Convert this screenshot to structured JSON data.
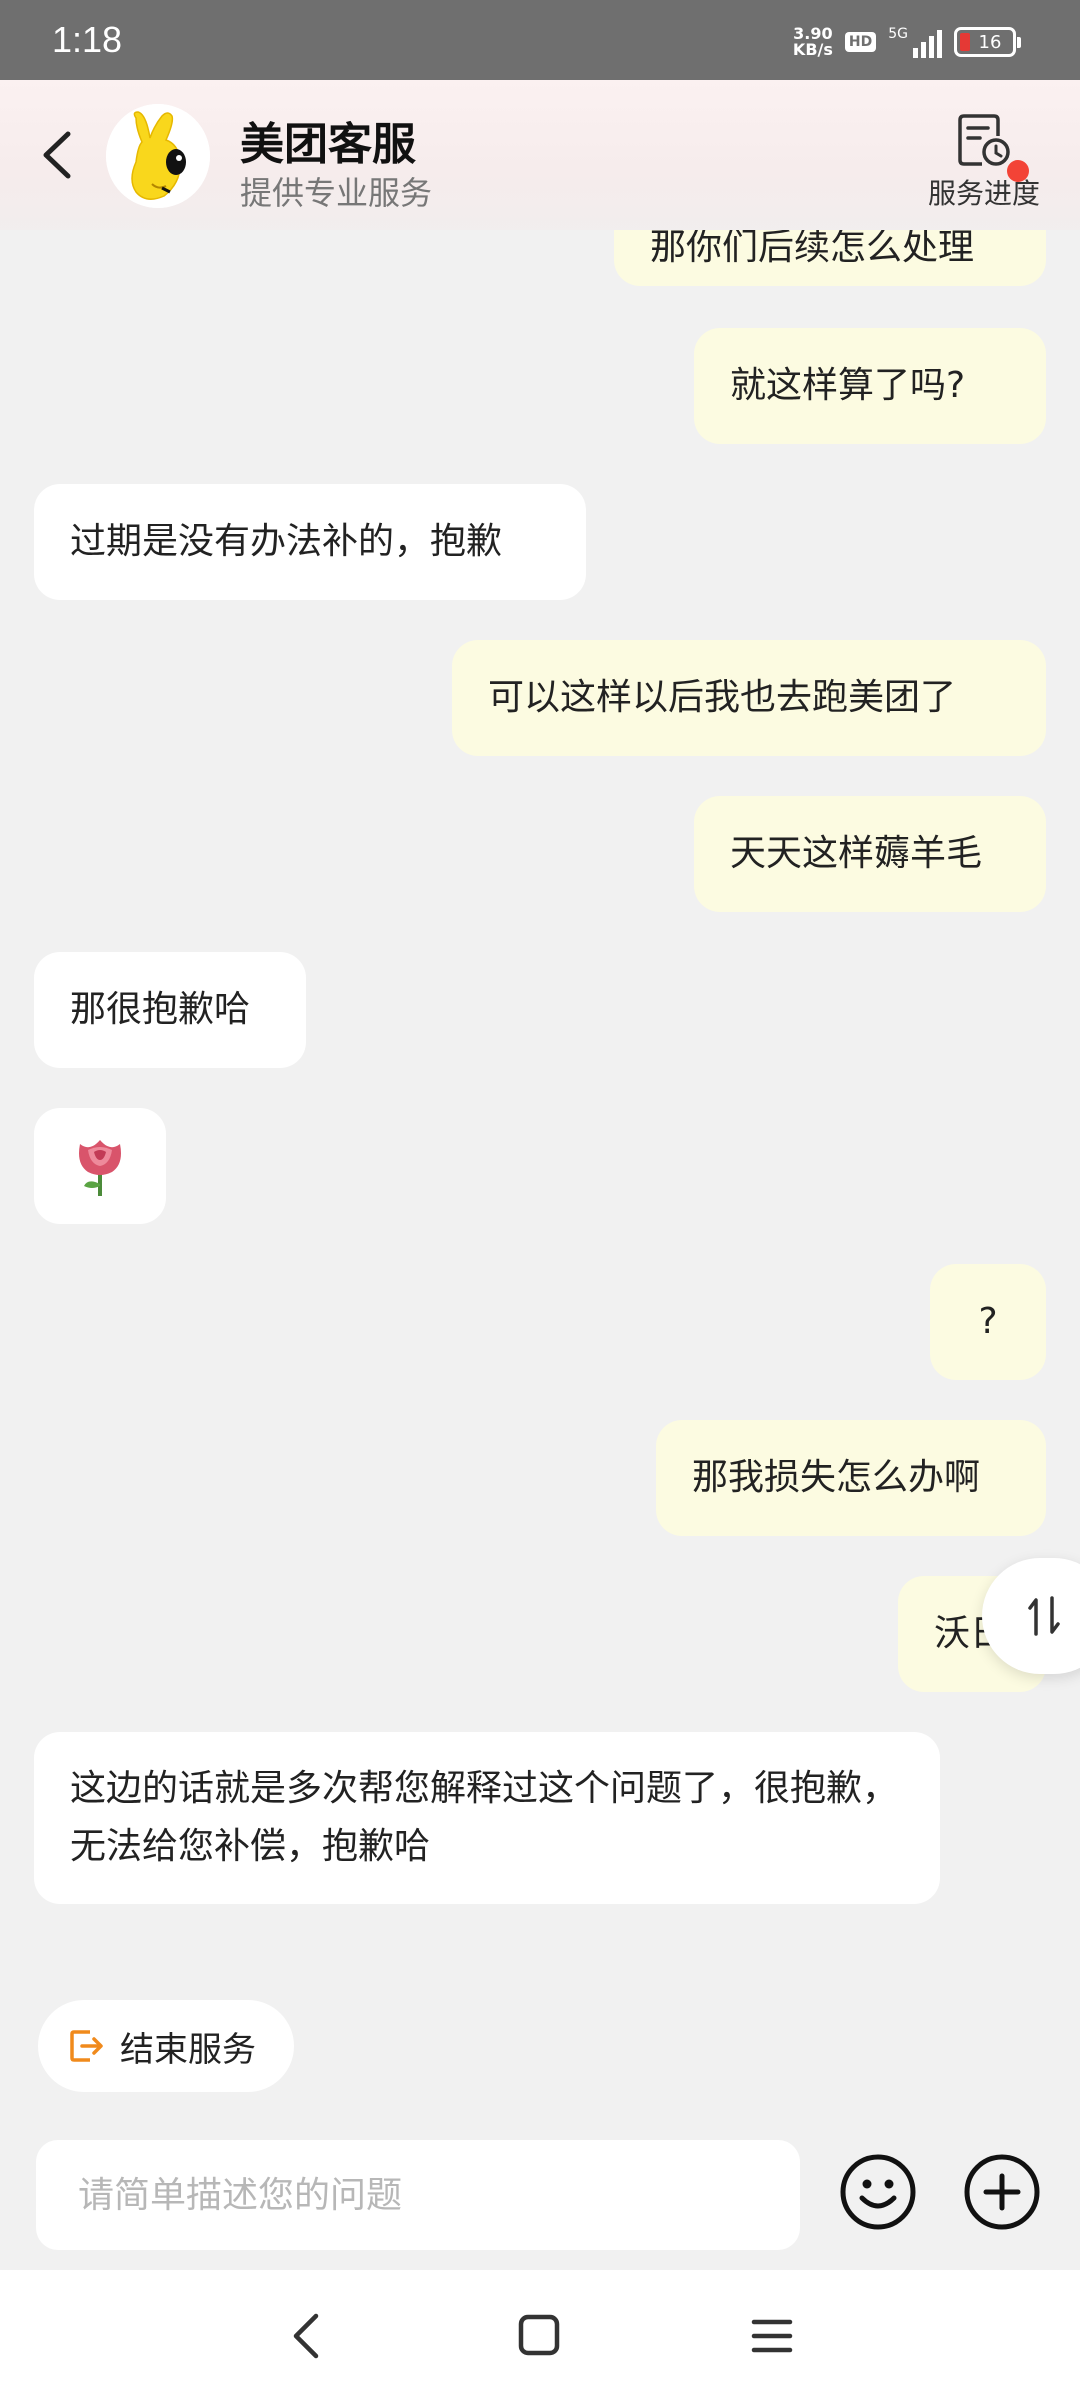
{
  "status_bar": {
    "time": "1:18",
    "net_speed_value": "3.90",
    "net_speed_unit": "KB/s",
    "hd": "HD",
    "network": "5G",
    "battery": "16"
  },
  "header": {
    "title": "美团客服",
    "subtitle": "提供专业服务",
    "progress_label": "服务进度"
  },
  "messages": [
    {
      "side": "sent",
      "text": "那你们后续怎么处理"
    },
    {
      "side": "sent",
      "text": "就这样算了吗?"
    },
    {
      "side": "recv",
      "text": "过期是没有办法补的，抱歉"
    },
    {
      "side": "sent",
      "text": "可以这样以后我也去跑美团了"
    },
    {
      "side": "sent",
      "text": "天天这样薅羊毛"
    },
    {
      "side": "recv",
      "text": "那很抱歉哈"
    },
    {
      "side": "recv",
      "text": "",
      "emoji": "rose"
    },
    {
      "side": "sent",
      "text": "?"
    },
    {
      "side": "sent",
      "text": "那我损失怎么办啊"
    },
    {
      "side": "sent",
      "text": "沃日"
    },
    {
      "side": "recv",
      "text": "这边的话就是多次帮您解释过这个问题了，很抱歉，无法给您补偿，抱歉哈"
    }
  ],
  "scroll_fab_icon": "swap-vertical-icon",
  "end_service_label": "结束服务",
  "input": {
    "placeholder": "请简单描述您的问题",
    "value": ""
  },
  "colors": {
    "sent_bubble": "#fcfbe1",
    "recv_bubble": "#ffffff",
    "accent": "#f08a1c",
    "badge": "#f34336"
  }
}
